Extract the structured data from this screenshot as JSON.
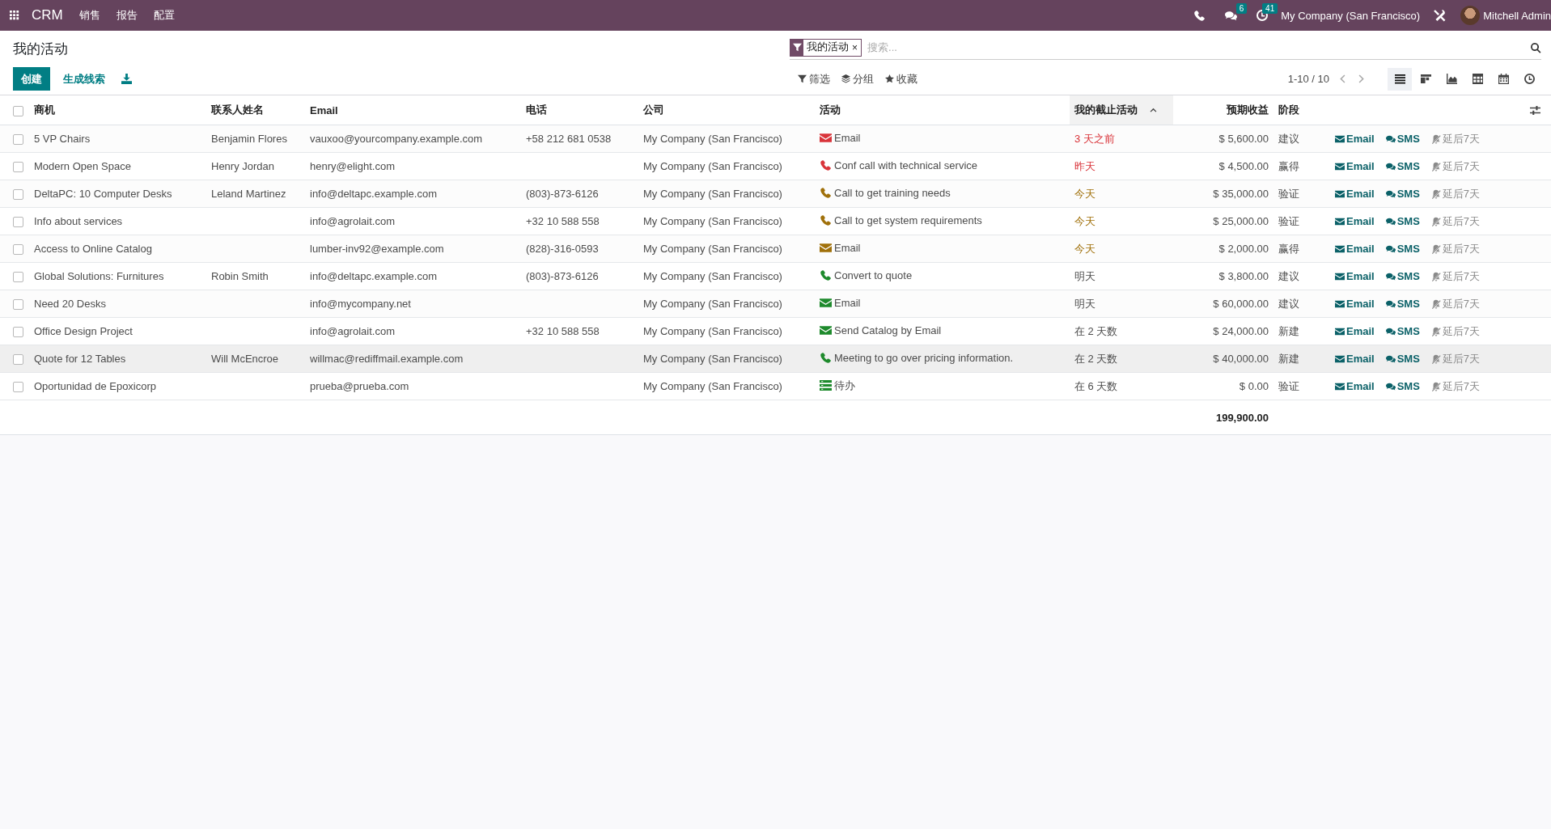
{
  "topbar": {
    "app": "CRM",
    "menus": [
      "销售",
      "报告",
      "配置"
    ],
    "messages_badge": "6",
    "activities_badge": "41",
    "company": "My Company (San Francisco)",
    "user": "Mitchell Admin"
  },
  "control_panel": {
    "title": "我的活动",
    "create_button": "创建",
    "generate_button": "生成线索",
    "facet": {
      "label": "我的活动",
      "remove": "×"
    },
    "search": {
      "placeholder": "搜索..."
    },
    "filters": [
      {
        "kind": "filter",
        "label": "筛选"
      },
      {
        "kind": "group",
        "label": "分组"
      },
      {
        "kind": "favorite",
        "label": "收藏"
      }
    ],
    "pager": "1-10 / 10",
    "views": [
      {
        "kind": "list",
        "selected": true
      },
      {
        "kind": "kanban",
        "selected": false
      },
      {
        "kind": "graph",
        "selected": false
      },
      {
        "kind": "pivot",
        "selected": false
      },
      {
        "kind": "calendar",
        "selected": false
      },
      {
        "kind": "activity",
        "selected": false
      }
    ]
  },
  "table": {
    "all_checked": false,
    "columns": [
      {
        "label": "商机",
        "sorted": false
      },
      {
        "label": "联系人姓名",
        "sorted": false
      },
      {
        "label": "Email",
        "sorted": false
      },
      {
        "label": "电话",
        "sorted": false
      },
      {
        "label": "公司",
        "sorted": false
      },
      {
        "label": "活动",
        "sorted": false
      },
      {
        "label": "我的截止活动",
        "sorted": true
      },
      {
        "label": "预期收益",
        "sorted": false
      },
      {
        "label": "阶段",
        "sorted": false
      }
    ],
    "rows": [
      {
        "checked": false,
        "highlighted": false,
        "opportunity": "5 VP Chairs",
        "contact": "Benjamin Flores",
        "email": "vauxoo@yourcompany.example.com",
        "phone": "+58 212 681 0538",
        "company": "My Company (San Francisco)",
        "activity": {
          "kind": "email",
          "label": "Email",
          "color": "#d9343a"
        },
        "deadline": {
          "label": "3 天之前",
          "color": "#d9343a"
        },
        "revenue": "$ 5,600.00",
        "stage": "建议",
        "actions": [
          "Email",
          "SMS",
          "延后7天"
        ]
      },
      {
        "checked": false,
        "highlighted": false,
        "opportunity": "Modern Open Space",
        "contact": "Henry Jordan",
        "email": "henry@elight.com",
        "phone": "",
        "company": "My Company (San Francisco)",
        "activity": {
          "kind": "call",
          "label": "Conf call with technical service",
          "color": "#d9343a"
        },
        "deadline": {
          "label": "昨天",
          "color": "#d9343a"
        },
        "revenue": "$ 4,500.00",
        "stage": "赢得",
        "actions": [
          "Email",
          "SMS",
          "延后7天"
        ]
      },
      {
        "checked": false,
        "highlighted": false,
        "opportunity": "DeltaPC: 10 Computer Desks",
        "contact": "Leland Martinez",
        "email": "info@deltapc.example.com",
        "phone": "(803)-873-6126",
        "company": "My Company (San Francisco)",
        "activity": {
          "kind": "call",
          "label": "Call to get training needs",
          "color": "#a0700a"
        },
        "deadline": {
          "label": "今天",
          "color": "#a0700a"
        },
        "revenue": "$ 35,000.00",
        "stage": "验证",
        "actions": [
          "Email",
          "SMS",
          "延后7天"
        ]
      },
      {
        "checked": false,
        "highlighted": false,
        "opportunity": "Info about services",
        "contact": "",
        "email": "info@agrolait.com",
        "phone": "+32 10 588 558",
        "company": "My Company (San Francisco)",
        "activity": {
          "kind": "call",
          "label": "Call to get system requirements",
          "color": "#a0700a"
        },
        "deadline": {
          "label": "今天",
          "color": "#a0700a"
        },
        "revenue": "$ 25,000.00",
        "stage": "验证",
        "actions": [
          "Email",
          "SMS",
          "延后7天"
        ]
      },
      {
        "checked": false,
        "highlighted": false,
        "opportunity": "Access to Online Catalog",
        "contact": "",
        "email": "lumber-inv92@example.com",
        "phone": "(828)-316-0593",
        "company": "My Company (San Francisco)",
        "activity": {
          "kind": "email",
          "label": "Email",
          "color": "#a0700a"
        },
        "deadline": {
          "label": "今天",
          "color": "#a0700a"
        },
        "revenue": "$ 2,000.00",
        "stage": "赢得",
        "actions": [
          "Email",
          "SMS",
          "延后7天"
        ]
      },
      {
        "checked": false,
        "highlighted": false,
        "opportunity": "Global Solutions: Furnitures",
        "contact": "Robin Smith",
        "email": "info@deltapc.example.com",
        "phone": "(803)-873-6126",
        "company": "My Company (San Francisco)",
        "activity": {
          "kind": "call",
          "label": "Convert to quote",
          "color": "#1e8a2c"
        },
        "deadline": {
          "label": "明天",
          "color": "#4c4c4c"
        },
        "revenue": "$ 3,800.00",
        "stage": "建议",
        "actions": [
          "Email",
          "SMS",
          "延后7天"
        ]
      },
      {
        "checked": false,
        "highlighted": false,
        "opportunity": "Need 20 Desks",
        "contact": "",
        "email": "info@mycompany.net",
        "phone": "",
        "company": "My Company (San Francisco)",
        "activity": {
          "kind": "email",
          "label": "Email",
          "color": "#1e8a2c"
        },
        "deadline": {
          "label": "明天",
          "color": "#4c4c4c"
        },
        "revenue": "$ 60,000.00",
        "stage": "建议",
        "actions": [
          "Email",
          "SMS",
          "延后7天"
        ]
      },
      {
        "checked": false,
        "highlighted": false,
        "opportunity": "Office Design Project",
        "contact": "",
        "email": "info@agrolait.com",
        "phone": "+32 10 588 558",
        "company": "My Company (San Francisco)",
        "activity": {
          "kind": "email",
          "label": "Send Catalog by Email",
          "color": "#1e8a2c"
        },
        "deadline": {
          "label": "在 2 天数",
          "color": "#4c4c4c"
        },
        "revenue": "$ 24,000.00",
        "stage": "新建",
        "actions": [
          "Email",
          "SMS",
          "延后7天"
        ]
      },
      {
        "checked": false,
        "highlighted": true,
        "opportunity": "Quote for 12 Tables",
        "contact": "Will McEncroe",
        "email": "willmac@rediffmail.example.com",
        "phone": "",
        "company": "My Company (San Francisco)",
        "activity": {
          "kind": "call",
          "label": "Meeting to go over pricing information.",
          "color": "#1e8a2c"
        },
        "deadline": {
          "label": "在 2 天数",
          "color": "#4c4c4c"
        },
        "revenue": "$ 40,000.00",
        "stage": "新建",
        "actions": [
          "Email",
          "SMS",
          "延后7天"
        ]
      },
      {
        "checked": false,
        "highlighted": false,
        "opportunity": "Oportunidad de Epoxicorp",
        "contact": "",
        "email": "prueba@prueba.com",
        "phone": "",
        "company": "My Company (San Francisco)",
        "activity": {
          "kind": "todo",
          "label": "待办",
          "color": "#1e8a2c"
        },
        "deadline": {
          "label": "在 6 天数",
          "color": "#4c4c4c"
        },
        "revenue": "$ 0.00",
        "stage": "验证",
        "actions": [
          "Email",
          "SMS",
          "延后7天"
        ]
      }
    ],
    "total": "199,900.00"
  }
}
